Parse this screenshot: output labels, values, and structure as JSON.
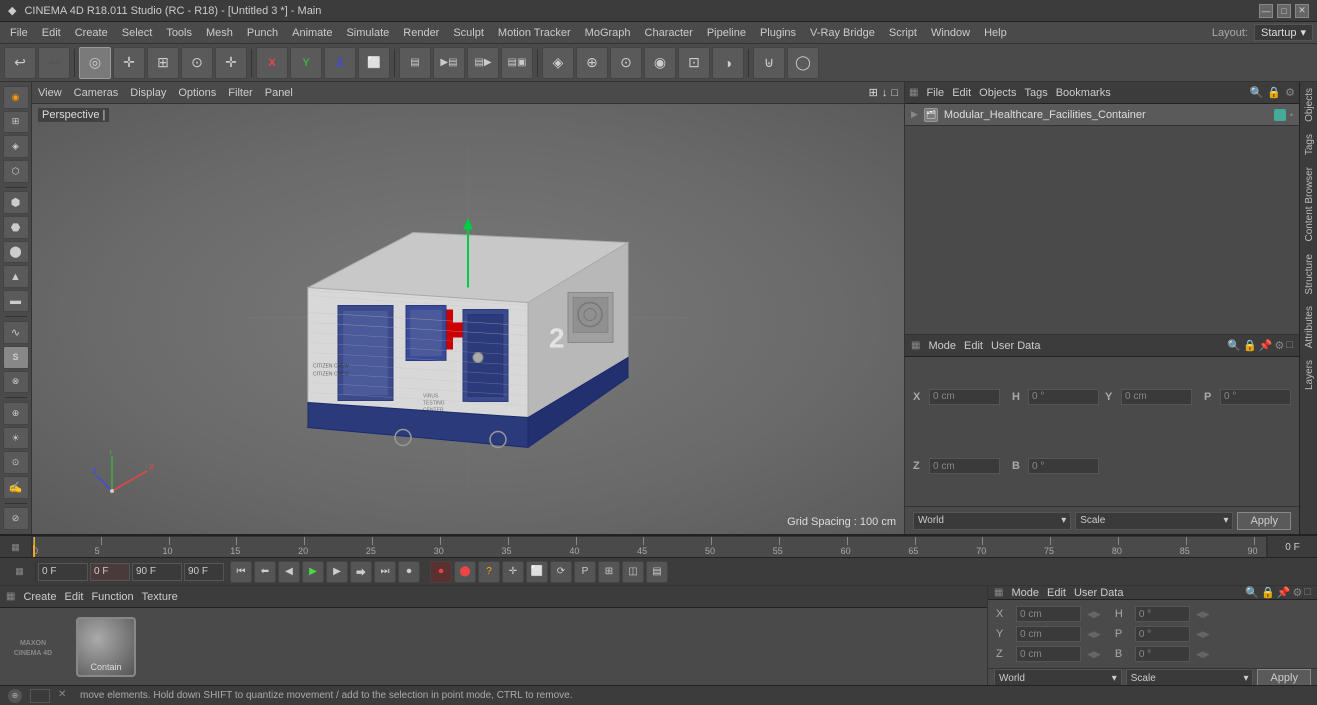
{
  "titleBar": {
    "icon": "◆",
    "title": "CINEMA 4D R18.011 Studio (RC - R18) - [Untitled 3 *] - Main",
    "minimize": "—",
    "maximize": "□",
    "close": "✕"
  },
  "menuBar": {
    "items": [
      "File",
      "Edit",
      "Create",
      "Select",
      "Tools",
      "Mesh",
      "Punch",
      "Animate",
      "Simulate",
      "Render",
      "Sculpt",
      "Motion Tracker",
      "MoGraph",
      "Character",
      "Pipeline",
      "Plugins",
      "V-Ray Bridge",
      "Script",
      "Window",
      "Help"
    ]
  },
  "layoutLabel": "Layout:",
  "layoutValue": "Startup",
  "toolbar": {
    "undo": "↩",
    "redo": "↪",
    "buttons": [
      "◉",
      "✛",
      "⊞",
      "⊙",
      "✛",
      "X",
      "Y",
      "Z",
      "⬜",
      "▶",
      "▣",
      "⊕",
      "◈",
      "⊙",
      "⊡",
      "◫",
      "◑",
      "⊎",
      "◉"
    ]
  },
  "leftToolbar": {
    "buttons": [
      "◉",
      "⊕",
      "⊞",
      "⊙",
      "◈",
      "⬡",
      "⬢",
      "⬣",
      "⬤",
      "▸",
      "⬠",
      "S",
      "⊗",
      "⊘",
      "⊙",
      "⊚",
      "⊛",
      "⊜",
      "⊝",
      "⬥"
    ]
  },
  "viewport": {
    "menuItems": [
      "View",
      "Cameras",
      "Display",
      "Options",
      "Filter",
      "Panel"
    ],
    "perspLabel": "Perspective |",
    "gridSpacing": "Grid Spacing : 100 cm",
    "topRightIcons": [
      "⊞",
      "↓",
      "□"
    ]
  },
  "rightPanel": {
    "toolbar": {
      "items": [
        "File",
        "Edit",
        "Objects",
        "Tags",
        "Bookmarks"
      ]
    },
    "objectName": "Modular_Healthcare_Facilities_Container",
    "objectIcon": "🗂",
    "searchIcon": "🔍"
  },
  "rightSideTabs": [
    "Objects",
    "Tags",
    "Content Browser",
    "Structure",
    "Attributes",
    "Layers"
  ],
  "timeline": {
    "startFrame": "0",
    "endFrame": "90",
    "marks": [
      0,
      5,
      10,
      15,
      20,
      25,
      30,
      35,
      40,
      45,
      50,
      55,
      60,
      65,
      70,
      75,
      80,
      85,
      90
    ],
    "currentFrame": "0 F"
  },
  "playback": {
    "frameStart": "0 F",
    "frameEnd": "90 F",
    "frameEnd2": "90 F",
    "currentFrame": "0 F",
    "buttons": [
      "⏮",
      "◀◀",
      "◀",
      "▶",
      "▶▶",
      "⏭",
      "⏺"
    ]
  },
  "bottomPanel": {
    "toolbar": {
      "items": [
        "Create",
        "Edit",
        "Function",
        "Texture"
      ]
    },
    "material": {
      "label": "Contain",
      "type": "sphere"
    }
  },
  "coordsPanel": {
    "toolbar": {
      "items": [
        "Mode",
        "Edit",
        "User Data"
      ]
    },
    "coords": {
      "x_pos": "0 cm",
      "y_pos": "0 cm",
      "z_pos": "0 cm",
      "x_rot": "0 cm",
      "y_rot": "0 cm",
      "z_rot": "0 cm",
      "h": "0 °",
      "p": "0 °",
      "b": "0 °"
    },
    "footer": {
      "world": "World",
      "scale": "Scale",
      "apply": "Apply"
    }
  },
  "statusBar": {
    "text": "move elements. Hold down SHIFT to quantize movement / add to the selection in point mode, CTRL to remove.",
    "icons": [
      "⊕",
      "□",
      "✕"
    ]
  },
  "playbackIcons": {
    "record": "⏺",
    "stop": "⏹",
    "autokey": "⏺",
    "move": "✛",
    "select": "⬜",
    "rotate": "⟳",
    "pivot": "P",
    "grid": "⊞",
    "snap": "◫"
  }
}
